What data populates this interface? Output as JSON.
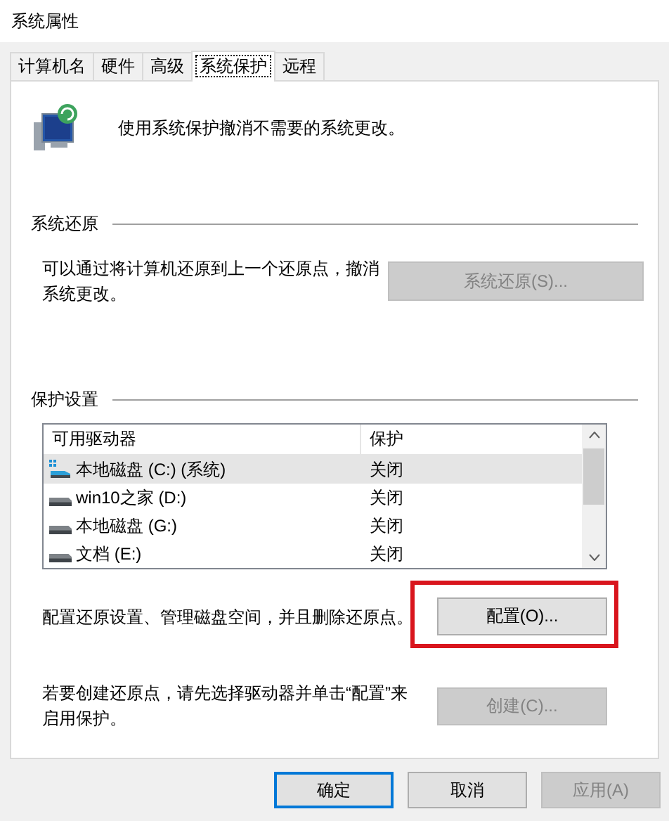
{
  "window": {
    "title": "系统属性"
  },
  "tabs": [
    {
      "label": "计算机名",
      "selected": false
    },
    {
      "label": "硬件",
      "selected": false
    },
    {
      "label": "高级",
      "selected": false
    },
    {
      "label": "系统保护",
      "selected": true
    },
    {
      "label": "远程",
      "selected": false
    }
  ],
  "header": {
    "text": "使用系统保护撤消不需要的系统更改。"
  },
  "restore_group": {
    "title": "系统还原",
    "text": "可以通过将计算机还原到上一个还原点，撤消系统更改。",
    "button": {
      "label": "系统还原(S)...",
      "disabled": true
    }
  },
  "protection_group": {
    "title": "保护设置",
    "table": {
      "columns": [
        "可用驱动器",
        "保护"
      ],
      "rows": [
        {
          "kind": "system",
          "drive": "本地磁盘 (C:) (系统)",
          "protection": "关闭",
          "selected": true
        },
        {
          "kind": "drive",
          "drive": "win10之家 (D:)",
          "protection": "关闭",
          "selected": false
        },
        {
          "kind": "drive",
          "drive": "本地磁盘 (G:)",
          "protection": "关闭",
          "selected": false
        },
        {
          "kind": "drive",
          "drive": "文档 (E:)",
          "protection": "关闭",
          "selected": false
        }
      ]
    },
    "configure": {
      "text": "配置还原设置、管理磁盘空间，并且删除还原点。",
      "button": {
        "label": "配置(O)...",
        "disabled": false,
        "highlighted": true
      }
    },
    "create": {
      "text": "若要创建还原点，请先选择驱动器并单击“配置”来启用保护。",
      "button": {
        "label": "创建(C)...",
        "disabled": true
      }
    }
  },
  "buttons": [
    {
      "label": "确定",
      "default": true,
      "disabled": false
    },
    {
      "label": "取消",
      "default": false,
      "disabled": false
    },
    {
      "label": "应用(A)",
      "default": false,
      "disabled": true
    }
  ]
}
